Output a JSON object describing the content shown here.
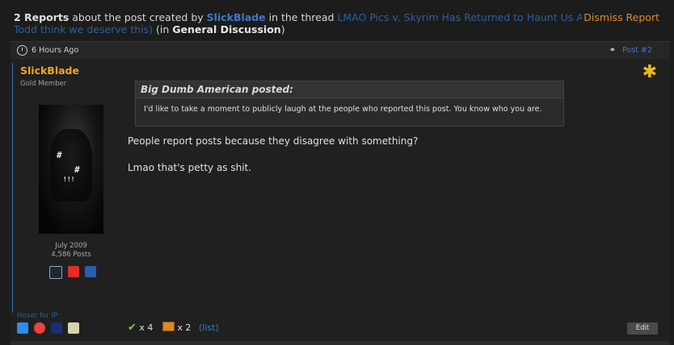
{
  "report": {
    "count": "2 Reports",
    "about": " about the post created by ",
    "author": "SlickBlade",
    "in_thread": " in the thread ",
    "thread": "LMAO Pics v. Skyrim Has Returned to Haunt Us All (Why does Todd think we deserve this)",
    "in_open": " (in ",
    "forum": "General Discussion",
    "in_close": ")",
    "dismiss": "Dismiss Report"
  },
  "post": {
    "time": "6 Hours Ago",
    "number": "Post #2",
    "username": "SlickBlade",
    "user_title": "Gold Member",
    "join_date": "July 2009",
    "post_count": "4,586 Posts",
    "hover_ip": "Hover for IP",
    "quote_author": "Big Dumb American posted:",
    "quote_text": "I'd like to take a moment to publicly laugh at the people who reported this post. You know who you are.",
    "message_line1": "People report posts because they disagree with something?",
    "message_line2": "Lmao that's petty as shit.",
    "likes": "x 4",
    "boxes": "x 2",
    "list_link": "(list)",
    "edit": "Edit"
  },
  "icons": {
    "services": [
      "steam-icon",
      "youtube-icon",
      "playstation-icon"
    ],
    "browser": [
      "windows-icon",
      "chrome-icon",
      "australia-flag-icon",
      "calendar-icon"
    ]
  },
  "colors": {
    "accent_orange": "#f0a51e",
    "link_blue": "#3c78c8",
    "dismiss_orange": "#e08a2a"
  }
}
